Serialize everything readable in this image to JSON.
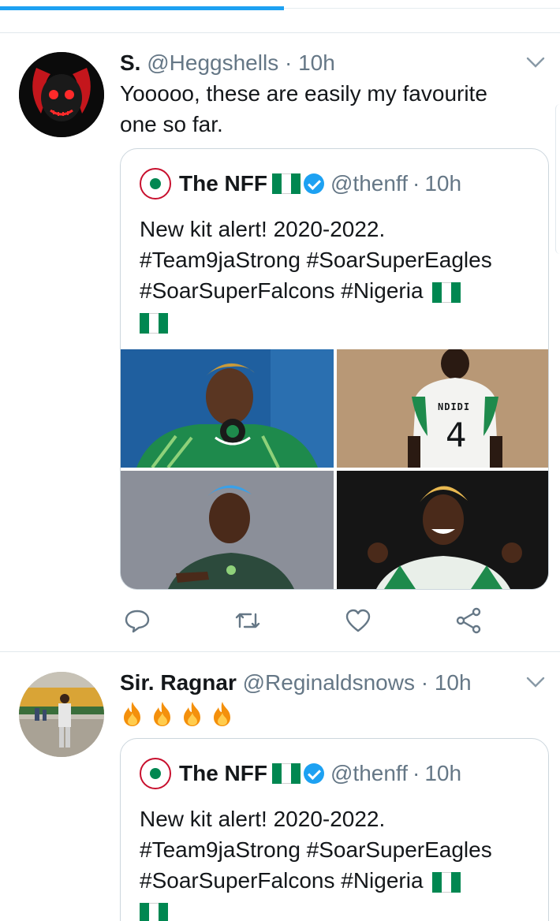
{
  "colors": {
    "accent": "#1da1f2",
    "text": "#14171a",
    "muted": "#657786",
    "nigeria_green": "#008751"
  },
  "tweets": [
    {
      "name": "S.",
      "handle": "@Heggshells",
      "separator": "·",
      "time": "10h",
      "text": "Yooooo, these are easily my favourite one so far.",
      "quote": {
        "name": "The NFF",
        "handle": "@thenff",
        "separator": "·",
        "time": "10h",
        "line1": "New kit alert! 2020-2022.",
        "line2": "#Team9jaStrong #SoarSuperEagles",
        "line3": "#SoarSuperFalcons #Nigeria",
        "jersey_name": "NDIDI",
        "jersey_number": "4"
      },
      "actions": [
        "reply-icon",
        "retweet-icon",
        "like-icon",
        "share-icon"
      ]
    },
    {
      "name": "Sir. Ragnar",
      "handle": "@Reginaldsnows",
      "separator": "·",
      "time": "10h",
      "emoji": [
        "fire",
        "fire",
        "fire",
        "fire"
      ],
      "quote": {
        "name": "The NFF",
        "handle": "@thenff",
        "separator": "·",
        "time": "10h",
        "line1": "New kit alert! 2020-2022.",
        "line2": "#Team9jaStrong #SoarSuperEagles",
        "line3": "#SoarSuperFalcons #Nigeria"
      }
    }
  ]
}
